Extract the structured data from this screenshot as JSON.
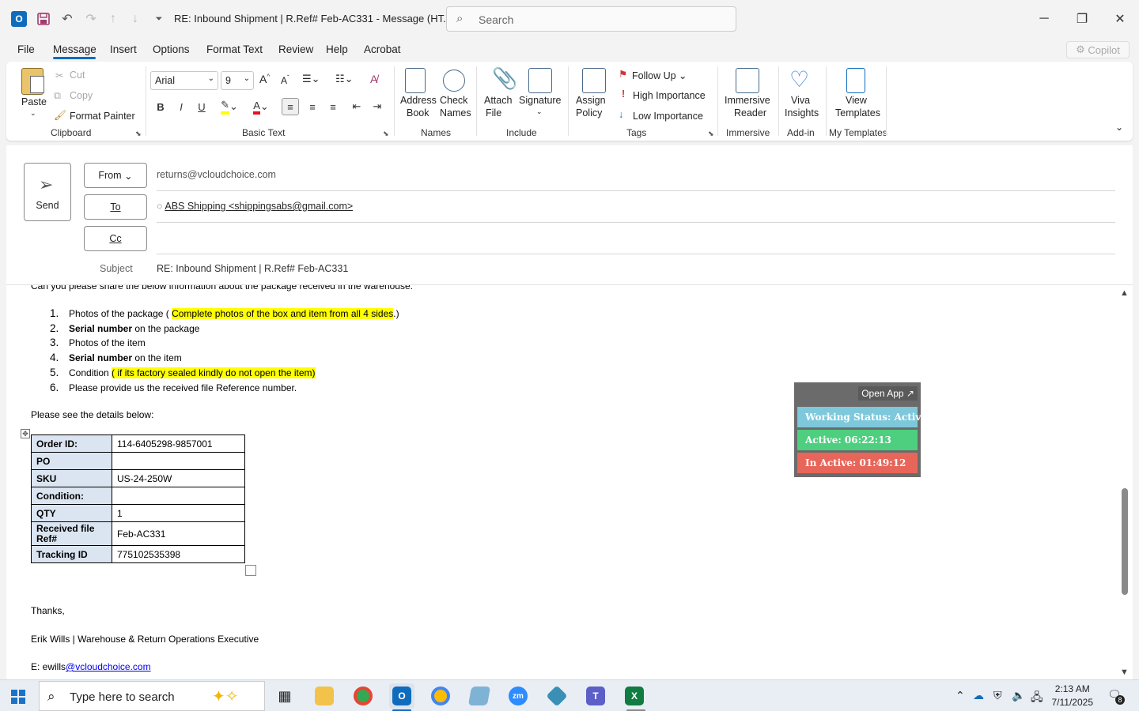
{
  "window": {
    "title": "RE: Inbound Shipment | R.Ref# Feb-AC331  -  Message (HT...",
    "search_placeholder": "Search"
  },
  "menu": {
    "items": [
      "File",
      "Message",
      "Insert",
      "Options",
      "Format Text",
      "Review",
      "Help",
      "Acrobat"
    ],
    "active": "Message",
    "copilot": "Copilot"
  },
  "ribbon": {
    "clipboard": {
      "paste": "Paste",
      "cut": "Cut",
      "copy": "Copy",
      "format_painter": "Format Painter",
      "label": "Clipboard"
    },
    "basic_text": {
      "font": "Arial",
      "size": "9",
      "label": "Basic Text"
    },
    "names": {
      "address_book": [
        "Address",
        "Book"
      ],
      "check_names": [
        "Check",
        "Names"
      ],
      "label": "Names"
    },
    "include": {
      "attach_file": [
        "Attach",
        "File"
      ],
      "signature": "Signature",
      "label": "Include"
    },
    "tags": {
      "assign_policy": [
        "Assign",
        "Policy"
      ],
      "follow_up": "Follow Up",
      "high_importance": "High Importance",
      "low_importance": "Low Importance",
      "label": "Tags"
    },
    "immersive": {
      "reader": [
        "Immersive",
        "Reader"
      ],
      "label": "Immersive"
    },
    "addin": {
      "viva": [
        "Viva",
        "Insights"
      ],
      "label": "Add-in"
    },
    "templates": {
      "view": [
        "View",
        "Templates"
      ],
      "label": "My Templates"
    }
  },
  "compose": {
    "send": "Send",
    "from_label": "From",
    "from_value": "returns@vcloudchoice.com",
    "to_label": "To",
    "to_value": "ABS Shipping <shippingsabs@gmail.com>",
    "cc_label": "Cc",
    "subject_label": "Subject",
    "subject_value": "RE: Inbound Shipment | R.Ref# Feb-AC331"
  },
  "body": {
    "cut_line": "Can you please share the below information about the package received in the warehouse.",
    "list": [
      {
        "num": "1.",
        "text": "Photos of the package (",
        "hl": "Complete photos of the box and item from all 4 sides",
        "tail": ".)"
      },
      {
        "num": "2.",
        "bold": "Serial number",
        "text": " on the package"
      },
      {
        "num": "3.",
        "text": "Photos of the item"
      },
      {
        "num": "4.",
        "bold": "Serial number",
        "text": " on the item"
      },
      {
        "num": "5.",
        "text": "Condition ",
        "hl": "( if its factory sealed kindly do not open the item)"
      },
      {
        "num": "6.",
        "text": "Please provide us the received file Reference number."
      }
    ],
    "details_intro": "Please see the details below:",
    "table": [
      {
        "k": "Order ID:",
        "v": "114-6405298-9857001"
      },
      {
        "k": "PO",
        "v": ""
      },
      {
        "k": "SKU",
        "v": "US-24-250W"
      },
      {
        "k": "Condition:",
        "v": ""
      },
      {
        "k": "QTY",
        "v": "1"
      },
      {
        "k": "Received file Ref#",
        "v": "Feb-AC331"
      },
      {
        "k": "Tracking ID",
        "v": "775102535398"
      }
    ],
    "thanks": "Thanks,",
    "signature": "Erik Wills | Warehouse & Return Operations Executive",
    "email_prefix": "E: ewills",
    "email_link": "@vcloudchoice.com"
  },
  "widget": {
    "open_app": "Open App ↗",
    "status": "Working Status: Active",
    "active": "Active: 06:22:13",
    "inactive": "In Active: 01:49:12",
    "colors": {
      "status": "#7ec8dc",
      "active": "#4dcf7f",
      "inactive": "#e8655a"
    }
  },
  "taskbar": {
    "search_placeholder": "Type here to search",
    "time": "2:13 AM",
    "date": "7/11/2025",
    "notifications": "8"
  },
  "colors": {
    "accent": "#0f6cbd",
    "highlight": "#ffff00",
    "table_key_bg": "#dbe5f1"
  }
}
